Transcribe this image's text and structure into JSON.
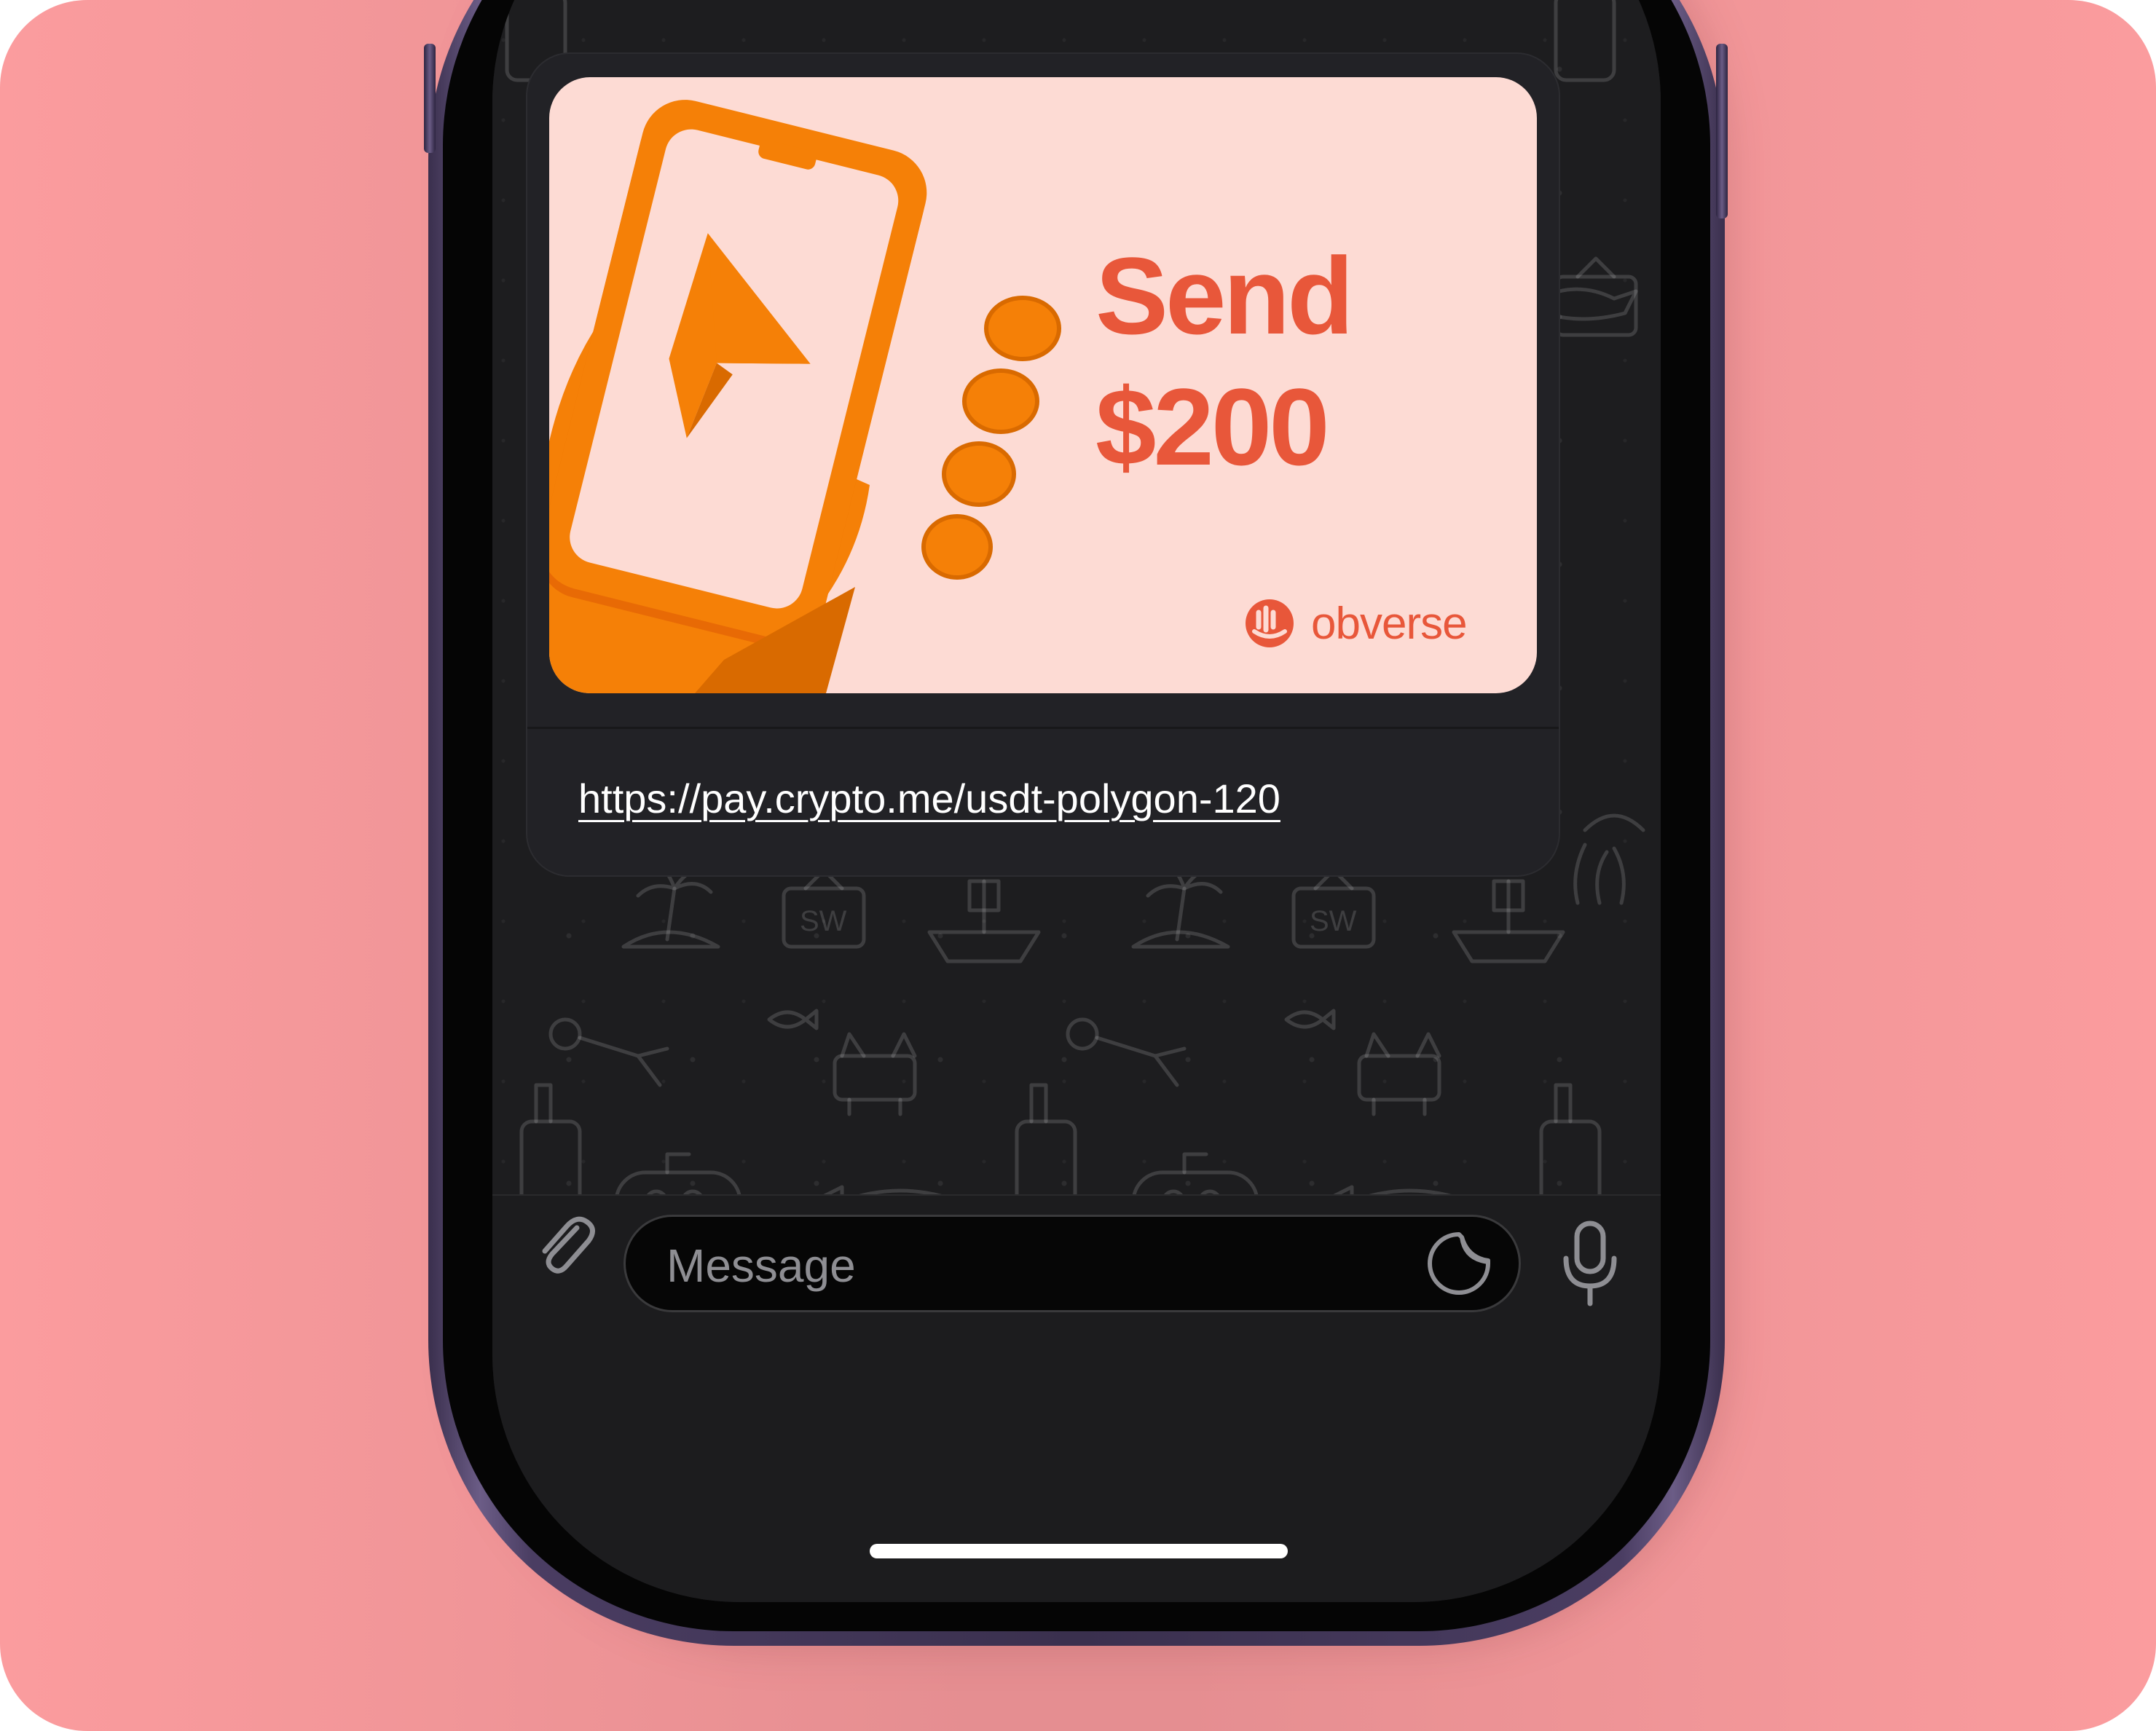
{
  "background_color": "#fb9c9e",
  "message": {
    "preview": {
      "headline_line1": "Send",
      "headline_line2": "$200",
      "brand_name": "obverse",
      "accent_color": "#e8573a",
      "illustration": "hand-holding-phone-with-paper-plane"
    },
    "link_text": "https://pay.crypto.me/usdt-polygon-120"
  },
  "composer": {
    "placeholder": "Message",
    "attach_icon": "paperclip-icon",
    "sticker_icon": "sticker-icon",
    "mic_icon": "microphone-icon"
  }
}
